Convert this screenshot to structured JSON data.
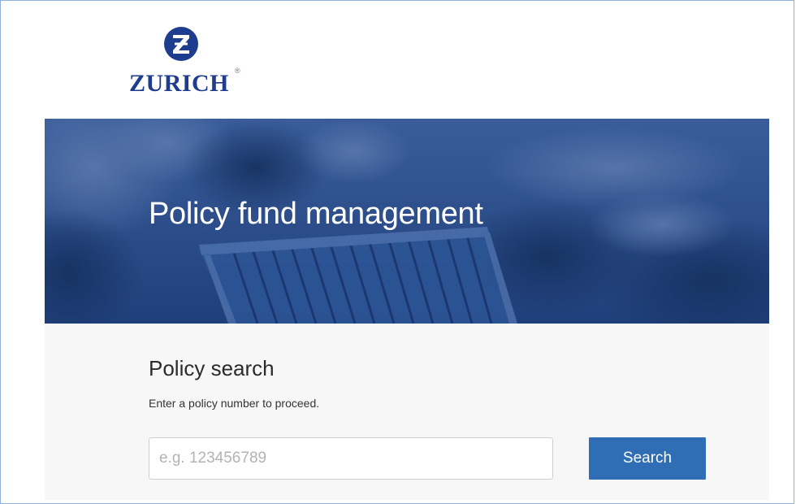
{
  "brand": {
    "name": "ZURICH",
    "registered_mark": "®",
    "logo_icon": "zurich-z-logo-icon",
    "brand_color": "#1e3d8f"
  },
  "hero": {
    "title": "Policy fund management",
    "background": "deck-chair-garden-photo"
  },
  "search": {
    "title": "Policy search",
    "instruction": "Enter a policy number to proceed.",
    "placeholder": "e.g. 123456789",
    "value": "",
    "button_label": "Search",
    "button_color": "#2f6db5"
  }
}
